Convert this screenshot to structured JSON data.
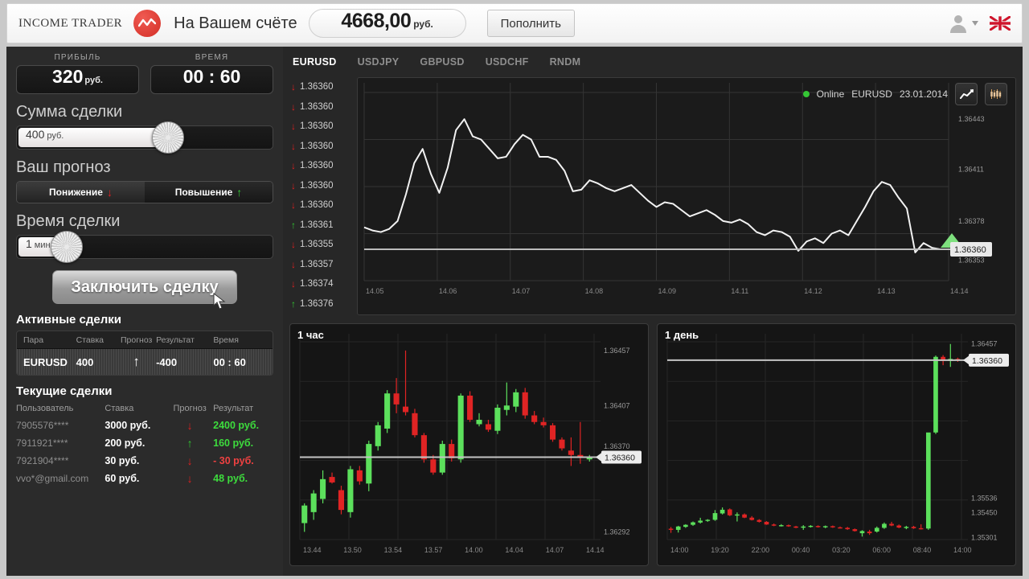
{
  "header": {
    "brand": "INCOME TRADER",
    "logo_icon": "zigzag-logo-icon",
    "account_label": "На Вашем счёте",
    "balance_value": "4668,00",
    "balance_currency": "руб.",
    "topup_label": "Пополнить",
    "avatar_icon": "user-avatar-icon",
    "flag_icon": "uk-flag-icon"
  },
  "sidebar": {
    "profit_caption": "ПРИБЫЛЬ",
    "profit_value": "320",
    "profit_unit": "руб.",
    "time_caption": "ВРЕМЯ",
    "time_value": "00 : 60",
    "amount_title": "Сумма сделки",
    "amount_value": "400",
    "amount_unit": "руб.",
    "forecast_title": "Ваш прогноз",
    "forecast_down": "Понижение",
    "forecast_up": "Повышение",
    "down_arrow": "↓",
    "up_arrow": "↑",
    "duration_title": "Время сделки",
    "duration_value": "1",
    "duration_unit": "мин.",
    "cta_label": "Заключить сделку",
    "active_title": "Активные сделки",
    "active_headers": [
      "Пара",
      "Ставка",
      "Прогноз",
      "Результат",
      "Время"
    ],
    "active_rows": [
      {
        "pair": "EURUSD",
        "bet": "400",
        "forecast": "↑",
        "forecast_dir": "up",
        "result": "-400",
        "time": "00 : 60"
      }
    ],
    "current_title": "Текущие сделки",
    "current_headers": [
      "Пользователь",
      "Ставка",
      "Прогноз",
      "Результат"
    ],
    "current_rows": [
      {
        "user": "7905576****",
        "bet": "3000 руб.",
        "forecast": "↓",
        "forecast_dir": "down",
        "result": "2400 руб.",
        "result_positive": true
      },
      {
        "user": "7911921****",
        "bet": "200 руб.",
        "forecast": "↑",
        "forecast_dir": "up",
        "result": "160 руб.",
        "result_positive": true
      },
      {
        "user": "7921904****",
        "bet": "30 руб.",
        "forecast": "↓",
        "forecast_dir": "down",
        "result": "- 30 руб.",
        "result_positive": false
      },
      {
        "user": "vvo*@gmail.com",
        "bet": "60 руб.",
        "forecast": "↓",
        "forecast_dir": "down",
        "result": "48 руб.",
        "result_positive": true
      }
    ]
  },
  "colors": {
    "up_green": "#32c832",
    "down_red": "#e02020",
    "candle_green": "#5ce05c",
    "candle_red": "#e02424",
    "accent_red": "#d32f26",
    "line_white": "#f2f2f2"
  },
  "instrument_tabs": [
    {
      "label": "EURUSD",
      "active": true
    },
    {
      "label": "USDJPY",
      "active": false
    },
    {
      "label": "GBPUSD",
      "active": false
    },
    {
      "label": "USDCHF",
      "active": false
    },
    {
      "label": "RNDM",
      "active": false
    }
  ],
  "ladder": [
    {
      "price": "1.36360",
      "dir": "down"
    },
    {
      "price": "1.36360",
      "dir": "down"
    },
    {
      "price": "1.36360",
      "dir": "down"
    },
    {
      "price": "1.36360",
      "dir": "down"
    },
    {
      "price": "1.36360",
      "dir": "down"
    },
    {
      "price": "1.36360",
      "dir": "down"
    },
    {
      "price": "1.36360",
      "dir": "down"
    },
    {
      "price": "1.36361",
      "dir": "up"
    },
    {
      "price": "1.36355",
      "dir": "down"
    },
    {
      "price": "1.36357",
      "dir": "down"
    },
    {
      "price": "1.36374",
      "dir": "down"
    },
    {
      "price": "1.36376",
      "dir": "up"
    }
  ],
  "main_chart_head": {
    "status": "Online",
    "symbol": "EURUSD",
    "date": "23.01.2014",
    "line_btn_icon": "line-chart-icon",
    "candle_btn_icon": "candlestick-chart-icon"
  },
  "chart_data": [
    {
      "id": "main-line-chart",
      "type": "line",
      "title": "",
      "symbol": "EURUSD",
      "date": "23.01.2014",
      "status": "Online",
      "xlabel": "",
      "ylabel": "",
      "grid": true,
      "legend": "none",
      "x_ticks": [
        "14.05",
        "14.06",
        "14.07",
        "14.08",
        "14.09",
        "14.11",
        "14.12",
        "14.13",
        "14.14"
      ],
      "y_ticks": [
        "1.36443",
        "1.36411",
        "1.36378",
        "1.36353"
      ],
      "ylim": [
        1.3634,
        1.3646
      ],
      "current_price": "1.36360",
      "marker_color": "#7ee07e",
      "values": [
        1.36374,
        1.36372,
        1.36371,
        1.36373,
        1.36378,
        1.36395,
        1.36415,
        1.36424,
        1.36408,
        1.36396,
        1.36412,
        1.36436,
        1.36443,
        1.36432,
        1.3643,
        1.36424,
        1.36418,
        1.36419,
        1.36427,
        1.36433,
        1.3643,
        1.36419,
        1.36419,
        1.36417,
        1.3641,
        1.36397,
        1.36398,
        1.36404,
        1.36402,
        1.36399,
        1.36397,
        1.36399,
        1.36401,
        1.36396,
        1.36391,
        1.36387,
        1.3639,
        1.36389,
        1.36385,
        1.36381,
        1.36383,
        1.36385,
        1.36382,
        1.36378,
        1.36377,
        1.36379,
        1.36376,
        1.36371,
        1.36369,
        1.36372,
        1.36371,
        1.36368,
        1.36359,
        1.36365,
        1.36367,
        1.36364,
        1.3637,
        1.36372,
        1.36369,
        1.36378,
        1.36387,
        1.36397,
        1.36403,
        1.36401,
        1.36393,
        1.36386,
        1.36358,
        1.36364,
        1.36361,
        1.3636,
        1.3636
      ]
    },
    {
      "id": "hour-candle-chart",
      "type": "candlestick",
      "title": "1 час",
      "grid": true,
      "legend": "none",
      "x_ticks": [
        "13.44",
        "13.50",
        "13.54",
        "13.57",
        "14.00",
        "14.04",
        "14.07",
        "14.14"
      ],
      "y_ticks": [
        "1.36457",
        "1.36407",
        "1.36370",
        "1.36292"
      ],
      "ylim": [
        1.36285,
        1.36465
      ],
      "current_price": "1.36360",
      "candles": [
        {
          "o": 1.363,
          "h": 1.36318,
          "l": 1.36292,
          "c": 1.36316,
          "d": "up"
        },
        {
          "o": 1.3631,
          "h": 1.3633,
          "l": 1.36303,
          "c": 1.36327,
          "d": "up"
        },
        {
          "o": 1.36322,
          "h": 1.36348,
          "l": 1.36318,
          "c": 1.3634,
          "d": "up"
        },
        {
          "o": 1.36342,
          "h": 1.36346,
          "l": 1.36336,
          "c": 1.36337,
          "d": "down"
        },
        {
          "o": 1.3633,
          "h": 1.36334,
          "l": 1.36308,
          "c": 1.36312,
          "d": "down"
        },
        {
          "o": 1.3631,
          "h": 1.36352,
          "l": 1.36305,
          "c": 1.36349,
          "d": "up"
        },
        {
          "o": 1.36348,
          "h": 1.36352,
          "l": 1.36335,
          "c": 1.36338,
          "d": "down"
        },
        {
          "o": 1.36336,
          "h": 1.36375,
          "l": 1.36329,
          "c": 1.36372,
          "d": "up"
        },
        {
          "o": 1.3637,
          "h": 1.36392,
          "l": 1.36366,
          "c": 1.36389,
          "d": "up"
        },
        {
          "o": 1.36386,
          "h": 1.36421,
          "l": 1.36382,
          "c": 1.36418,
          "d": "up"
        },
        {
          "o": 1.36418,
          "h": 1.36432,
          "l": 1.364,
          "c": 1.36408,
          "d": "down"
        },
        {
          "o": 1.36406,
          "h": 1.36457,
          "l": 1.36398,
          "c": 1.36401,
          "d": "down"
        },
        {
          "o": 1.364,
          "h": 1.36404,
          "l": 1.36378,
          "c": 1.3638,
          "d": "down"
        },
        {
          "o": 1.3638,
          "h": 1.36382,
          "l": 1.36355,
          "c": 1.36358,
          "d": "down"
        },
        {
          "o": 1.36358,
          "h": 1.36362,
          "l": 1.36344,
          "c": 1.36346,
          "d": "down"
        },
        {
          "o": 1.36346,
          "h": 1.36375,
          "l": 1.36344,
          "c": 1.36372,
          "d": "up"
        },
        {
          "o": 1.36372,
          "h": 1.36376,
          "l": 1.36356,
          "c": 1.36359,
          "d": "down"
        },
        {
          "o": 1.36358,
          "h": 1.36418,
          "l": 1.36355,
          "c": 1.36416,
          "d": "up"
        },
        {
          "o": 1.36416,
          "h": 1.3642,
          "l": 1.36392,
          "c": 1.36394,
          "d": "down"
        },
        {
          "o": 1.36394,
          "h": 1.364,
          "l": 1.36388,
          "c": 1.3639,
          "d": "up"
        },
        {
          "o": 1.3639,
          "h": 1.36394,
          "l": 1.36383,
          "c": 1.36385,
          "d": "down"
        },
        {
          "o": 1.36384,
          "h": 1.36408,
          "l": 1.36381,
          "c": 1.36405,
          "d": "up"
        },
        {
          "o": 1.36403,
          "h": 1.36428,
          "l": 1.36398,
          "c": 1.36407,
          "d": "up"
        },
        {
          "o": 1.36406,
          "h": 1.36422,
          "l": 1.36401,
          "c": 1.36419,
          "d": "up"
        },
        {
          "o": 1.36419,
          "h": 1.36423,
          "l": 1.36395,
          "c": 1.36398,
          "d": "down"
        },
        {
          "o": 1.36398,
          "h": 1.36402,
          "l": 1.3639,
          "c": 1.36392,
          "d": "down"
        },
        {
          "o": 1.36392,
          "h": 1.36396,
          "l": 1.36387,
          "c": 1.36389,
          "d": "down"
        },
        {
          "o": 1.36389,
          "h": 1.36391,
          "l": 1.36374,
          "c": 1.36376,
          "d": "down"
        },
        {
          "o": 1.36376,
          "h": 1.36378,
          "l": 1.36366,
          "c": 1.36368,
          "d": "down"
        },
        {
          "o": 1.36366,
          "h": 1.36378,
          "l": 1.36352,
          "c": 1.36362,
          "d": "down"
        },
        {
          "o": 1.36362,
          "h": 1.36392,
          "l": 1.36354,
          "c": 1.3636,
          "d": "down"
        },
        {
          "o": 1.36358,
          "h": 1.36362,
          "l": 1.36356,
          "c": 1.3636,
          "d": "up"
        }
      ]
    },
    {
      "id": "day-candle-chart",
      "type": "candlestick",
      "title": "1 день",
      "grid": true,
      "legend": "none",
      "x_ticks": [
        "14:00",
        "19:20",
        "22:00",
        "00:40",
        "03:20",
        "06:00",
        "08:40",
        "14:00"
      ],
      "y_ticks": [
        "1.36457",
        "1.35536",
        "1.35450",
        "1.35301"
      ],
      "ylim": [
        1.3529,
        1.3647
      ],
      "current_price": "1.36360",
      "candles": [
        {
          "o": 1.35355,
          "h": 1.35365,
          "l": 1.3533,
          "c": 1.35348,
          "d": "down"
        },
        {
          "o": 1.35348,
          "h": 1.35372,
          "l": 1.35332,
          "c": 1.35368,
          "d": "up"
        },
        {
          "o": 1.35366,
          "h": 1.35382,
          "l": 1.3536,
          "c": 1.35378,
          "d": "up"
        },
        {
          "o": 1.35378,
          "h": 1.35398,
          "l": 1.35372,
          "c": 1.35393,
          "d": "up"
        },
        {
          "o": 1.35392,
          "h": 1.3542,
          "l": 1.35386,
          "c": 1.35403,
          "d": "up"
        },
        {
          "o": 1.35402,
          "h": 1.35412,
          "l": 1.35396,
          "c": 1.35408,
          "d": "up"
        },
        {
          "o": 1.35408,
          "h": 1.35466,
          "l": 1.35402,
          "c": 1.35448,
          "d": "up"
        },
        {
          "o": 1.35446,
          "h": 1.35482,
          "l": 1.3544,
          "c": 1.35468,
          "d": "up"
        },
        {
          "o": 1.3547,
          "h": 1.35476,
          "l": 1.3543,
          "c": 1.35435,
          "d": "down"
        },
        {
          "o": 1.35434,
          "h": 1.35452,
          "l": 1.35398,
          "c": 1.3544,
          "d": "up"
        },
        {
          "o": 1.3544,
          "h": 1.35446,
          "l": 1.35418,
          "c": 1.35421,
          "d": "down"
        },
        {
          "o": 1.35421,
          "h": 1.3543,
          "l": 1.35404,
          "c": 1.35407,
          "d": "down"
        },
        {
          "o": 1.35407,
          "h": 1.35412,
          "l": 1.35392,
          "c": 1.35396,
          "d": "down"
        },
        {
          "o": 1.35396,
          "h": 1.354,
          "l": 1.35378,
          "c": 1.3538,
          "d": "down"
        },
        {
          "o": 1.3538,
          "h": 1.35386,
          "l": 1.3537,
          "c": 1.35373,
          "d": "down"
        },
        {
          "o": 1.35373,
          "h": 1.35382,
          "l": 1.35368,
          "c": 1.35376,
          "d": "up"
        },
        {
          "o": 1.35376,
          "h": 1.3538,
          "l": 1.35366,
          "c": 1.35369,
          "d": "down"
        },
        {
          "o": 1.35368,
          "h": 1.35372,
          "l": 1.35358,
          "c": 1.35361,
          "d": "down"
        },
        {
          "o": 1.35361,
          "h": 1.35376,
          "l": 1.35348,
          "c": 1.35368,
          "d": "up"
        },
        {
          "o": 1.35368,
          "h": 1.35376,
          "l": 1.35362,
          "c": 1.35372,
          "d": "up"
        },
        {
          "o": 1.35371,
          "h": 1.35375,
          "l": 1.35362,
          "c": 1.35365,
          "d": "down"
        },
        {
          "o": 1.35365,
          "h": 1.35374,
          "l": 1.35358,
          "c": 1.3537,
          "d": "up"
        },
        {
          "o": 1.3537,
          "h": 1.35374,
          "l": 1.3536,
          "c": 1.35363,
          "d": "down"
        },
        {
          "o": 1.35363,
          "h": 1.35368,
          "l": 1.35356,
          "c": 1.3536,
          "d": "down"
        },
        {
          "o": 1.3536,
          "h": 1.35366,
          "l": 1.35348,
          "c": 1.35352,
          "d": "down"
        },
        {
          "o": 1.35352,
          "h": 1.35356,
          "l": 1.35338,
          "c": 1.35341,
          "d": "down"
        },
        {
          "o": 1.35341,
          "h": 1.35346,
          "l": 1.35308,
          "c": 1.35328,
          "d": "up"
        },
        {
          "o": 1.35328,
          "h": 1.35348,
          "l": 1.35318,
          "c": 1.35338,
          "d": "down"
        },
        {
          "o": 1.35338,
          "h": 1.35368,
          "l": 1.35332,
          "c": 1.3536,
          "d": "up"
        },
        {
          "o": 1.3536,
          "h": 1.35392,
          "l": 1.35354,
          "c": 1.35384,
          "d": "up"
        },
        {
          "o": 1.35384,
          "h": 1.35396,
          "l": 1.3537,
          "c": 1.35374,
          "d": "down"
        },
        {
          "o": 1.35374,
          "h": 1.3538,
          "l": 1.35358,
          "c": 1.35362,
          "d": "down"
        },
        {
          "o": 1.35362,
          "h": 1.35372,
          "l": 1.35352,
          "c": 1.35366,
          "d": "up"
        },
        {
          "o": 1.35366,
          "h": 1.35372,
          "l": 1.35354,
          "c": 1.35358,
          "d": "down"
        },
        {
          "o": 1.35358,
          "h": 1.35382,
          "l": 1.3535,
          "c": 1.35356,
          "d": "down"
        },
        {
          "o": 1.35356,
          "h": 1.35362,
          "l": 1.35348,
          "c": 1.35929,
          "d": "up"
        },
        {
          "o": 1.35929,
          "h": 1.36388,
          "l": 1.3592,
          "c": 1.3638,
          "d": "up"
        },
        {
          "o": 1.3638,
          "h": 1.3639,
          "l": 1.3633,
          "c": 1.36355,
          "d": "down"
        },
        {
          "o": 1.36355,
          "h": 1.36457,
          "l": 1.3632,
          "c": 1.36368,
          "d": "up"
        },
        {
          "o": 1.36368,
          "h": 1.36375,
          "l": 1.3635,
          "c": 1.3636,
          "d": "down"
        }
      ]
    }
  ]
}
